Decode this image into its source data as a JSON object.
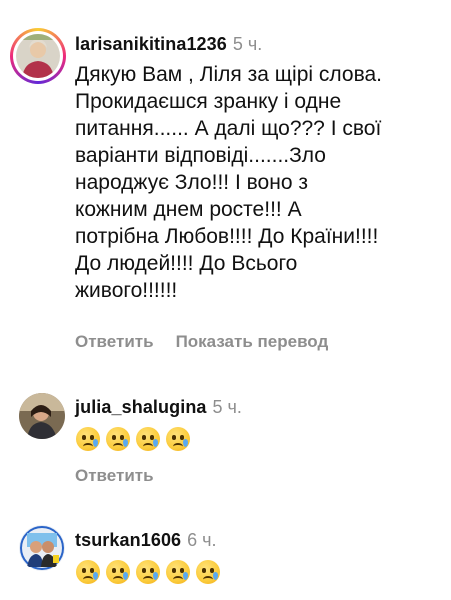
{
  "comments": [
    {
      "username": "larisanikitina1236",
      "time": "5 ч.",
      "text": "Дякую Вам , Ліля за щірі слова.\nПрокидаєшся зранку і одне\nпитання...... А далі що??? І свої\nваріанти відповіді.......Зло\nнароджує Зло!!! І воно з\nкожним днем росте!!! А\nпотрібна Любов!!!! До Країни!!!!\nДо людей!!!! До  Всього\nживого!!!!!!",
      "actions": [
        "Ответить",
        "Показать перевод"
      ]
    },
    {
      "username": "julia_shalugina",
      "time": "5 ч.",
      "emoji_count": 4,
      "emoji": "crying-face",
      "actions": [
        "Ответить"
      ]
    },
    {
      "username": "tsurkan1606",
      "time": "6 ч.",
      "emoji_count": 5,
      "emoji": "crying-face"
    }
  ]
}
